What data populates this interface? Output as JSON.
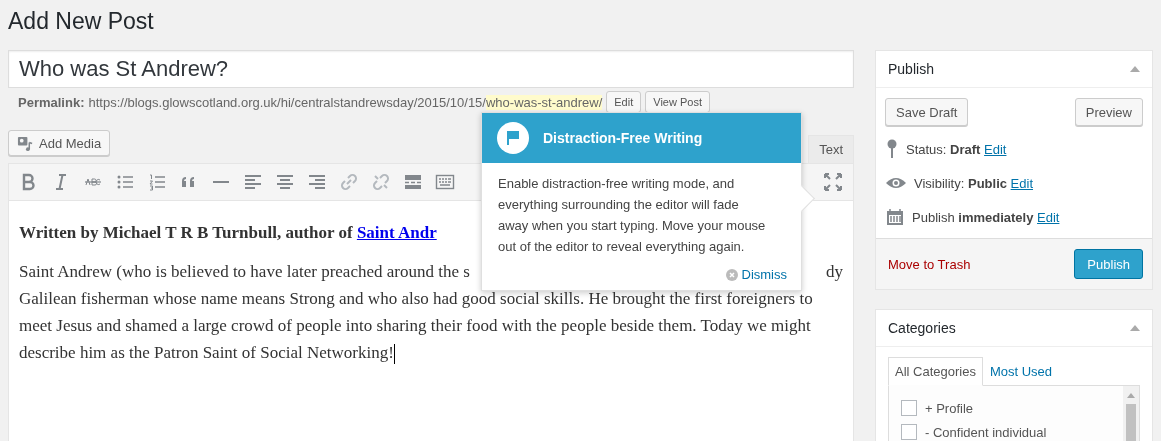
{
  "page_title": "Add New Post",
  "title_field": {
    "value": "Who was St Andrew?"
  },
  "permalink": {
    "label": "Permalink:",
    "base": "https://blogs.glowscotland.org.uk/hi/centralstandrewsday/2015/10/15/",
    "slug": "who-was-st-andrew/",
    "buttons": [
      "Edit",
      "View Post"
    ]
  },
  "add_media": "Add Media",
  "editor_tabs": [
    {
      "label": "Text",
      "selected": false
    }
  ],
  "content": {
    "byline": "Written by Michael T R B Turnbull, author of ",
    "byline_link": "Saint Andr",
    "first_line_start": "Saint Andrew (who is believed to have later preached around the s",
    "first_line_end": "dy",
    "lines": [
      "Galilean fisherman whose name means Strong and who also had good social skills. He brought the first foreigners to",
      "meet Jesus and shamed a large crowd of people into sharing their food with the people beside them. Today we might",
      "describe him as the Patron Saint of Social Networking!"
    ]
  },
  "pointer": {
    "title": "Distraction-Free Writing",
    "body": "Enable distraction-free writing mode, and everything surrounding the editor will fade away when you start typing. Move your mouse out of the editor to reveal everything again.",
    "dismiss": "Dismiss"
  },
  "publish": {
    "title": "Publish",
    "save_draft": "Save Draft",
    "preview": "Preview",
    "meta": [
      {
        "kind": "status",
        "label": "Status:",
        "value": "Draft",
        "link": "Edit"
      },
      {
        "kind": "visibility",
        "label": "Visibility:",
        "value": "Public",
        "link": "Edit"
      },
      {
        "kind": "schedule",
        "label": "Publish",
        "value": "immediately",
        "link": "Edit"
      }
    ],
    "trash": "Move to Trash",
    "publish_button": "Publish"
  },
  "categories": {
    "title": "Categories",
    "tabs": [
      {
        "label": "All Categories",
        "selected": true
      },
      {
        "label": "Most Used",
        "selected": false
      }
    ],
    "items": [
      {
        "label": "+ Profile",
        "checked": false
      },
      {
        "label": "- Confident individual",
        "checked": false
      }
    ]
  }
}
